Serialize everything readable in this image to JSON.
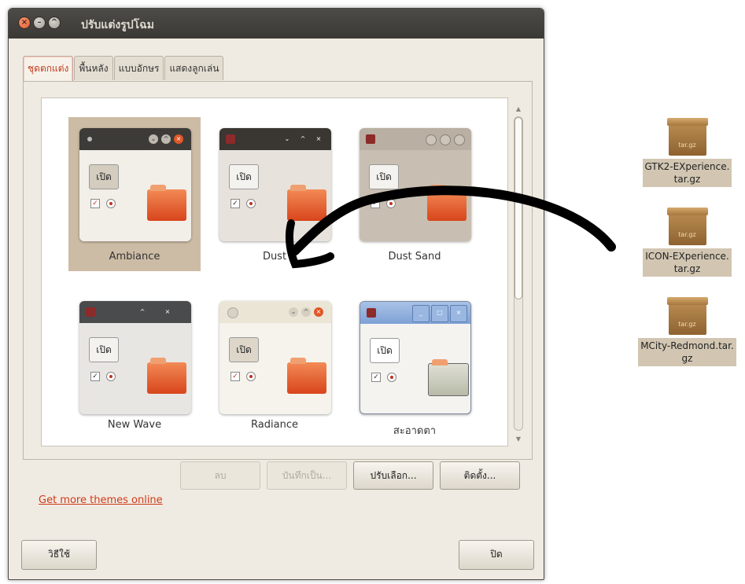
{
  "window": {
    "title": "ปรับแต่งรูปโฉม"
  },
  "tabs": [
    "ชุดตกแต่ง",
    "พื้นหลัง",
    "แบบอักษร",
    "แสดงลูกเล่น"
  ],
  "themes": [
    {
      "name": "Ambiance",
      "open_label": "เปิด"
    },
    {
      "name": "Dust",
      "open_label": "เปิด"
    },
    {
      "name": "Dust Sand",
      "open_label": "เปิด"
    },
    {
      "name": "New Wave",
      "open_label": "เปิด"
    },
    {
      "name": "Radiance",
      "open_label": "เปิด"
    },
    {
      "name": "สะอาดตา",
      "open_label": "เปิด"
    }
  ],
  "buttons": {
    "delete": "ลบ",
    "save_as": "บันทึกเป็น...",
    "customize": "ปรับเลือก...",
    "install": "ติดตั้ง..."
  },
  "link": "Get more themes online",
  "bottom": {
    "help": "วิธีใช้",
    "close": "ปิด"
  },
  "desktop_files": [
    {
      "icon_label": "tar.gz",
      "name_line1": "GTK2-EXperience.",
      "name_line2": "tar.gz"
    },
    {
      "icon_label": "tar.gz",
      "name_line1": "ICON-EXperience.",
      "name_line2": "tar.gz"
    },
    {
      "icon_label": "tar.gz",
      "name_line1": "MCity-Redmond.tar.",
      "name_line2": "gz"
    }
  ],
  "colors": {
    "accent": "#d03a1a",
    "titlebar": "#3c3b37",
    "selected_theme": "#cdbca5"
  }
}
